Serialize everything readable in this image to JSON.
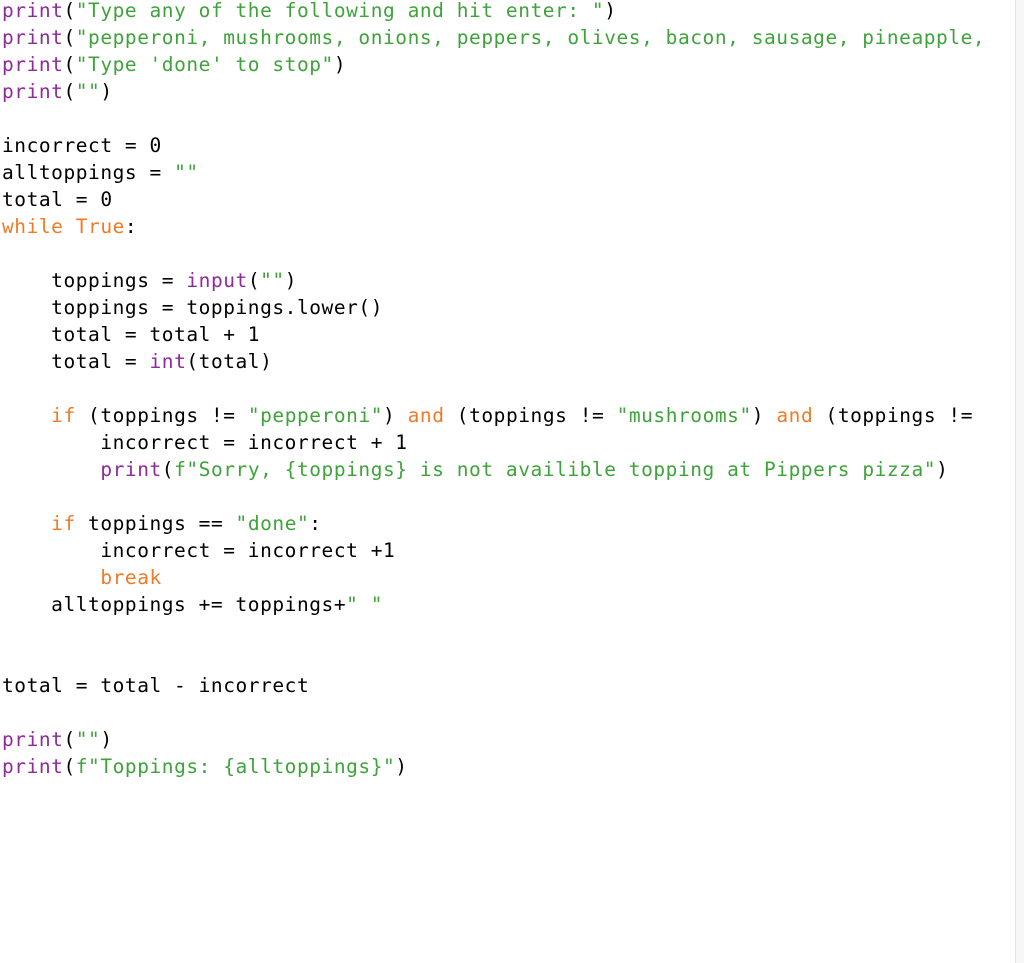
{
  "editor": {
    "language": "python",
    "colors": {
      "function": "#8f2a9b",
      "string": "#3fa33b",
      "keyword": "#f07a28",
      "plain": "#000000",
      "background": "#ffffff"
    },
    "lines": [
      {
        "tokens": [
          {
            "t": "fn",
            "v": "print"
          },
          {
            "t": "plain",
            "v": "("
          },
          {
            "t": "str",
            "v": "\"Type any of the following and hit enter: \""
          },
          {
            "t": "plain",
            "v": ")"
          }
        ]
      },
      {
        "tokens": [
          {
            "t": "fn",
            "v": "print"
          },
          {
            "t": "plain",
            "v": "("
          },
          {
            "t": "str",
            "v": "\"pepperoni, mushrooms, onions, peppers, olives, bacon, sausage, pineapple,"
          }
        ]
      },
      {
        "tokens": [
          {
            "t": "fn",
            "v": "print"
          },
          {
            "t": "plain",
            "v": "("
          },
          {
            "t": "str",
            "v": "\"Type 'done' to stop\""
          },
          {
            "t": "plain",
            "v": ")"
          }
        ]
      },
      {
        "tokens": [
          {
            "t": "fn",
            "v": "print"
          },
          {
            "t": "plain",
            "v": "("
          },
          {
            "t": "str",
            "v": "\"\""
          },
          {
            "t": "plain",
            "v": ")"
          }
        ]
      },
      {
        "tokens": []
      },
      {
        "tokens": [
          {
            "t": "plain",
            "v": "incorrect = 0"
          }
        ]
      },
      {
        "tokens": [
          {
            "t": "plain",
            "v": "alltoppings = "
          },
          {
            "t": "str",
            "v": "\"\""
          }
        ]
      },
      {
        "tokens": [
          {
            "t": "plain",
            "v": "total = 0"
          }
        ]
      },
      {
        "tokens": [
          {
            "t": "kw",
            "v": "while"
          },
          {
            "t": "plain",
            "v": " "
          },
          {
            "t": "kw",
            "v": "True"
          },
          {
            "t": "plain",
            "v": ":"
          }
        ]
      },
      {
        "tokens": []
      },
      {
        "tokens": [
          {
            "t": "plain",
            "v": "    toppings = "
          },
          {
            "t": "fn",
            "v": "input"
          },
          {
            "t": "plain",
            "v": "("
          },
          {
            "t": "str",
            "v": "\"\""
          },
          {
            "t": "plain",
            "v": ")"
          }
        ]
      },
      {
        "tokens": [
          {
            "t": "plain",
            "v": "    toppings = toppings.lower()"
          }
        ]
      },
      {
        "tokens": [
          {
            "t": "plain",
            "v": "    total = total + 1"
          }
        ]
      },
      {
        "tokens": [
          {
            "t": "plain",
            "v": "    total = "
          },
          {
            "t": "fn",
            "v": "int"
          },
          {
            "t": "plain",
            "v": "(total)"
          }
        ]
      },
      {
        "tokens": []
      },
      {
        "tokens": [
          {
            "t": "plain",
            "v": "    "
          },
          {
            "t": "kw",
            "v": "if"
          },
          {
            "t": "plain",
            "v": " (toppings != "
          },
          {
            "t": "str",
            "v": "\"pepperoni\""
          },
          {
            "t": "plain",
            "v": ") "
          },
          {
            "t": "kw",
            "v": "and"
          },
          {
            "t": "plain",
            "v": " (toppings != "
          },
          {
            "t": "str",
            "v": "\"mushrooms\""
          },
          {
            "t": "plain",
            "v": ") "
          },
          {
            "t": "kw",
            "v": "and"
          },
          {
            "t": "plain",
            "v": " (toppings !="
          }
        ]
      },
      {
        "tokens": [
          {
            "t": "plain",
            "v": "        incorrect = incorrect + 1"
          }
        ]
      },
      {
        "tokens": [
          {
            "t": "plain",
            "v": "        "
          },
          {
            "t": "fn",
            "v": "print"
          },
          {
            "t": "plain",
            "v": "("
          },
          {
            "t": "str",
            "v": "f\"Sorry, {toppings} is not availible topping at Pippers pizza\""
          },
          {
            "t": "plain",
            "v": ")"
          }
        ]
      },
      {
        "tokens": []
      },
      {
        "tokens": [
          {
            "t": "plain",
            "v": "    "
          },
          {
            "t": "kw",
            "v": "if"
          },
          {
            "t": "plain",
            "v": " toppings == "
          },
          {
            "t": "str",
            "v": "\"done\""
          },
          {
            "t": "plain",
            "v": ":"
          }
        ]
      },
      {
        "tokens": [
          {
            "t": "plain",
            "v": "        incorrect = incorrect +1"
          }
        ]
      },
      {
        "tokens": [
          {
            "t": "plain",
            "v": "        "
          },
          {
            "t": "kw",
            "v": "break"
          }
        ]
      },
      {
        "tokens": [
          {
            "t": "plain",
            "v": "    alltoppings += toppings+"
          },
          {
            "t": "str",
            "v": "\" \""
          }
        ]
      },
      {
        "tokens": []
      },
      {
        "tokens": []
      },
      {
        "tokens": [
          {
            "t": "plain",
            "v": "total = total - incorrect"
          }
        ]
      },
      {
        "tokens": []
      },
      {
        "tokens": [
          {
            "t": "fn",
            "v": "print"
          },
          {
            "t": "plain",
            "v": "("
          },
          {
            "t": "str",
            "v": "\"\""
          },
          {
            "t": "plain",
            "v": ")"
          }
        ]
      },
      {
        "tokens": [
          {
            "t": "fn",
            "v": "print"
          },
          {
            "t": "plain",
            "v": "("
          },
          {
            "t": "str",
            "v": "f\"Toppings: {alltoppings}\""
          },
          {
            "t": "plain",
            "v": ")"
          }
        ]
      }
    ]
  }
}
